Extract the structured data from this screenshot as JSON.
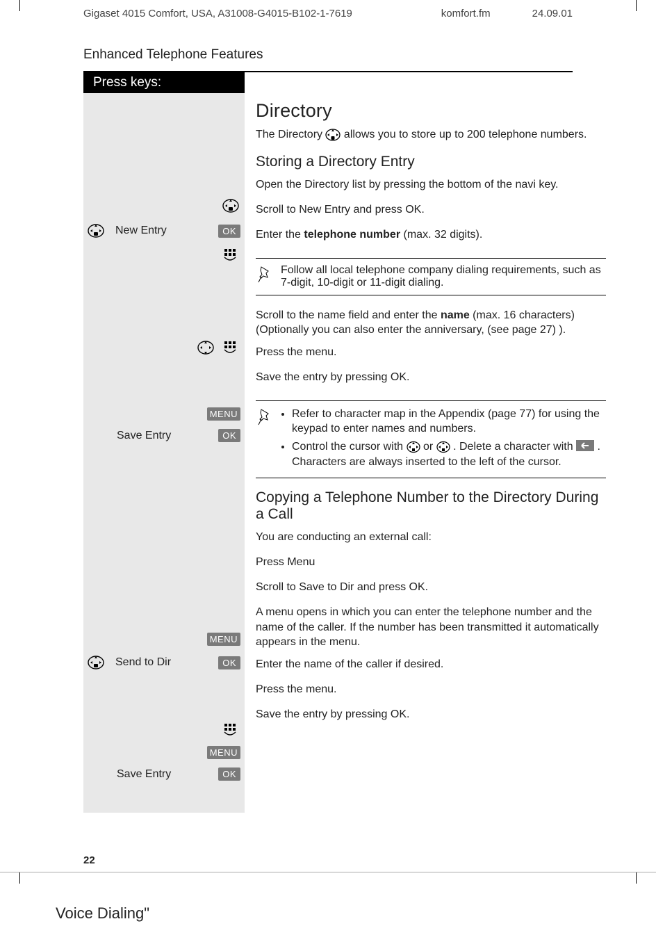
{
  "meta": {
    "product": "Gigaset 4015 Comfort, USA, A31008-G4015-B102-1-7619",
    "file": "komfort.fm",
    "date": "24.09.01"
  },
  "section_title": "Enhanced Telephone Features",
  "press_keys_label": "Press keys:",
  "h2_directory": "Directory",
  "p_intro_a": "The Directory ",
  "p_intro_b": " allows you to store up to 200 telephone numbers.",
  "h3_store": "Storing a Directory Entry",
  "step1": "Open the Directory list by pressing the bottom of the navi key.",
  "left_new_entry": "New Entry",
  "step2": "Scroll to New Entry and press OK.",
  "step3_a": "Enter the ",
  "step3_bold": "telephone number",
  "step3_b": " (max. 32 digits).",
  "note1": "Follow all local telephone company dialing requirements, such as 7-digit, 10-digit or 11-digit dialing.",
  "step4_a": "Scroll to the name field and enter the ",
  "step4_bold": "name",
  "step4_b": " (max. 16 characters)",
  "step4_c": "(Optionally you can also enter the anniversary, (see page 27) ).",
  "step5": "Press the menu.",
  "left_save_entry": "Save Entry",
  "step6": "Save the entry by pressing OK.",
  "note2_li1": "Refer to character map in the Appendix (page 77) for using the keypad to enter names and numbers.",
  "note2_li2_a": "Control the cursor with ",
  "note2_li2_b": " or ",
  "note2_li2_c": ". Delete a character with ",
  "note2_li2_d": ". Characters are always inserted to the left of the cursor.",
  "h3_copy": "Copying a Telephone Number to the Directory During a Call",
  "copy_p1": "You are conducting an external call:",
  "copy_step1": "Press Menu",
  "left_send_to_dir": "Send to Dir",
  "copy_step2": "Scroll to Save to Dir and press OK.",
  "copy_p2": "A menu opens in which you can enter the telephone number and the name of the caller. If the number has been transmitted it automatically appears in the menu.",
  "copy_step3": "Enter the name of the caller if desired.",
  "copy_step4": "Press the menu.",
  "copy_step5": "Save the entry by pressing OK.",
  "page_number": "22",
  "footer_title": "Voice Dialing\"",
  "badges": {
    "ok": "OK",
    "menu": "MENU"
  }
}
